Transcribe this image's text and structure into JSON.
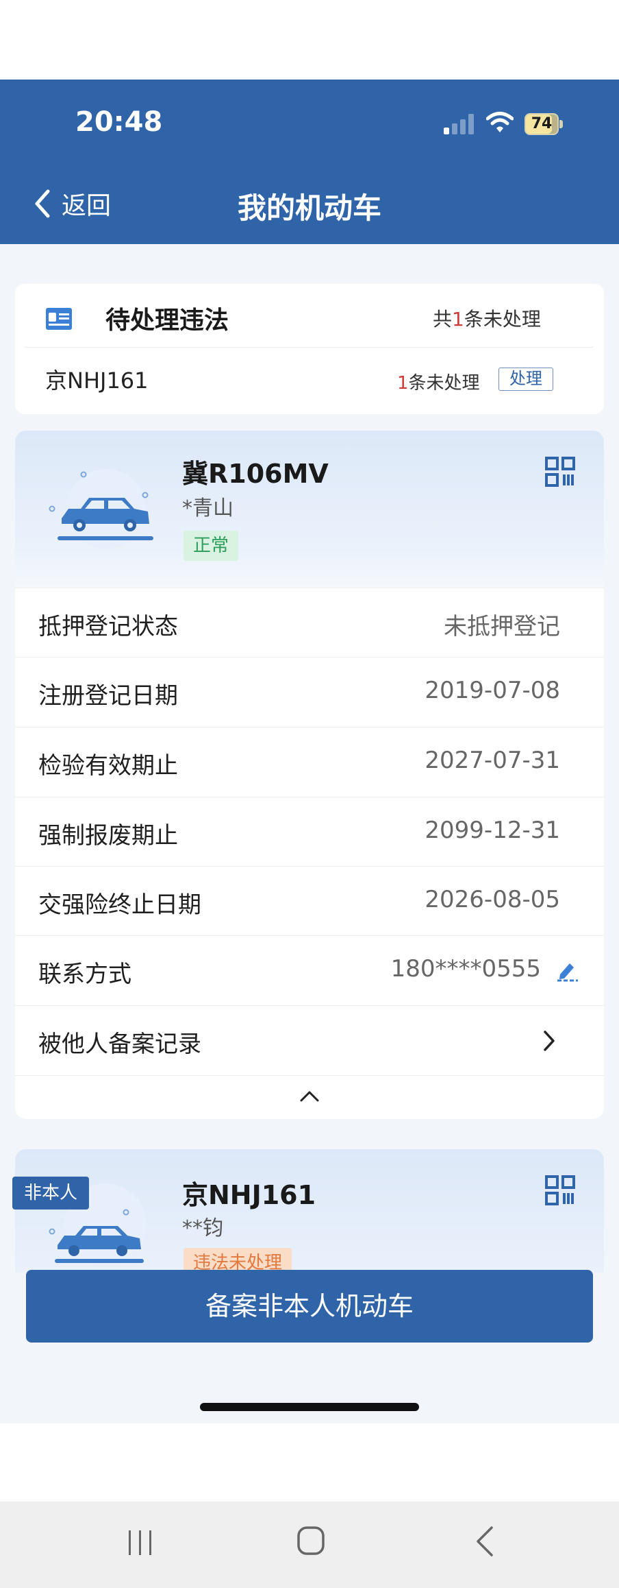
{
  "status_bar": {
    "time": "20:48",
    "battery": "74"
  },
  "nav": {
    "back_label": "返回",
    "title": "我的机动车"
  },
  "pending": {
    "title": "待处理违法",
    "summary_prefix": "共",
    "summary_count": "1",
    "summary_suffix": "条未处理",
    "plate": "京NHJ161",
    "plate_count": "1",
    "plate_count_suffix": "条未处理",
    "handle_label": "处理"
  },
  "vehicle1": {
    "plate": "冀R106MV",
    "owner": "*青山",
    "status": "正常",
    "rows": [
      {
        "label": "抵押登记状态",
        "value": "未抵押登记"
      },
      {
        "label": "注册登记日期",
        "value": "2019-07-08"
      },
      {
        "label": "检验有效期止",
        "value": "2027-07-31"
      },
      {
        "label": "强制报废期止",
        "value": "2099-12-31"
      },
      {
        "label": "交强险终止日期",
        "value": "2026-08-05"
      },
      {
        "label": "联系方式",
        "value": "180****0555"
      },
      {
        "label": "被他人备案记录",
        "value": ""
      }
    ]
  },
  "vehicle2": {
    "badge": "非本人",
    "plate": "京NHJ161",
    "owner": "**钧",
    "status": "违法未处理"
  },
  "register_button": "备案非本人机动车",
  "colors": {
    "brand_blue": "#2F64A8",
    "page_bg": "#F2F5FA",
    "ok_green": "#2E9D5B",
    "warn_orange": "#E27A3F",
    "alert_red": "#D23A3A"
  },
  "icons": [
    "signal-icon",
    "wifi-icon",
    "battery-icon",
    "back-chevron-icon",
    "id-card-icon",
    "car-icon",
    "qr-code-icon",
    "edit-icon",
    "chevron-right-icon",
    "chevron-up-icon",
    "recents-icon",
    "home-icon",
    "back-icon"
  ]
}
